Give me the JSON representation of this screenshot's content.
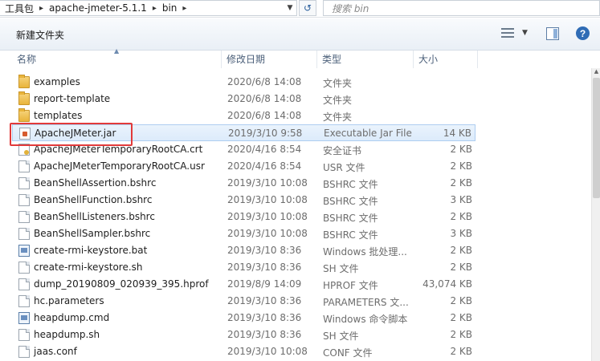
{
  "address": {
    "crumbs": [
      "工具包",
      "apache-jmeter-5.1.1",
      "bin"
    ],
    "separator": "▸"
  },
  "search": {
    "placeholder": "搜索 bin"
  },
  "toolbar": {
    "new_folder": "新建文件夹",
    "help": "?"
  },
  "columns": {
    "name": "名称",
    "date": "修改日期",
    "type": "类型",
    "size": "大小"
  },
  "files": [
    {
      "name": "examples",
      "date": "2020/6/8 14:08",
      "type": "文件夹",
      "size": "",
      "icon": "folder-icon"
    },
    {
      "name": "report-template",
      "date": "2020/6/8 14:08",
      "type": "文件夹",
      "size": "",
      "icon": "folder-icon"
    },
    {
      "name": "templates",
      "date": "2020/6/8 14:08",
      "type": "文件夹",
      "size": "",
      "icon": "folder-icon"
    },
    {
      "name": "ApacheJMeter.jar",
      "date": "2019/3/10 9:58",
      "type": "Executable Jar File",
      "size": "14 KB",
      "icon": "jar-icon",
      "selected": true
    },
    {
      "name": "ApacheJMeterTemporaryRootCA.crt",
      "date": "2020/4/16 8:54",
      "type": "安全证书",
      "size": "2 KB",
      "icon": "cert-icon"
    },
    {
      "name": "ApacheJMeterTemporaryRootCA.usr",
      "date": "2020/4/16 8:54",
      "type": "USR 文件",
      "size": "2 KB",
      "icon": "file-icon"
    },
    {
      "name": "BeanShellAssertion.bshrc",
      "date": "2019/3/10 10:08",
      "type": "BSHRC 文件",
      "size": "2 KB",
      "icon": "file-icon"
    },
    {
      "name": "BeanShellFunction.bshrc",
      "date": "2019/3/10 10:08",
      "type": "BSHRC 文件",
      "size": "3 KB",
      "icon": "file-icon"
    },
    {
      "name": "BeanShellListeners.bshrc",
      "date": "2019/3/10 10:08",
      "type": "BSHRC 文件",
      "size": "2 KB",
      "icon": "file-icon"
    },
    {
      "name": "BeanShellSampler.bshrc",
      "date": "2019/3/10 10:08",
      "type": "BSHRC 文件",
      "size": "3 KB",
      "icon": "file-icon"
    },
    {
      "name": "create-rmi-keystore.bat",
      "date": "2019/3/10 8:36",
      "type": "Windows 批处理...",
      "size": "2 KB",
      "icon": "bat-icon"
    },
    {
      "name": "create-rmi-keystore.sh",
      "date": "2019/3/10 8:36",
      "type": "SH 文件",
      "size": "2 KB",
      "icon": "file-icon"
    },
    {
      "name": "dump_20190809_020939_395.hprof",
      "date": "2019/8/9 14:09",
      "type": "HPROF 文件",
      "size": "43,074 KB",
      "icon": "file-icon"
    },
    {
      "name": "hc.parameters",
      "date": "2019/3/10 8:36",
      "type": "PARAMETERS 文...",
      "size": "2 KB",
      "icon": "file-icon"
    },
    {
      "name": "heapdump.cmd",
      "date": "2019/3/10 8:36",
      "type": "Windows 命令脚本",
      "size": "2 KB",
      "icon": "bat-icon"
    },
    {
      "name": "heapdump.sh",
      "date": "2019/3/10 8:36",
      "type": "SH 文件",
      "size": "2 KB",
      "icon": "file-icon"
    },
    {
      "name": "jaas.conf",
      "date": "2019/3/10 10:08",
      "type": "CONF 文件",
      "size": "2 KB",
      "icon": "file-icon"
    }
  ]
}
